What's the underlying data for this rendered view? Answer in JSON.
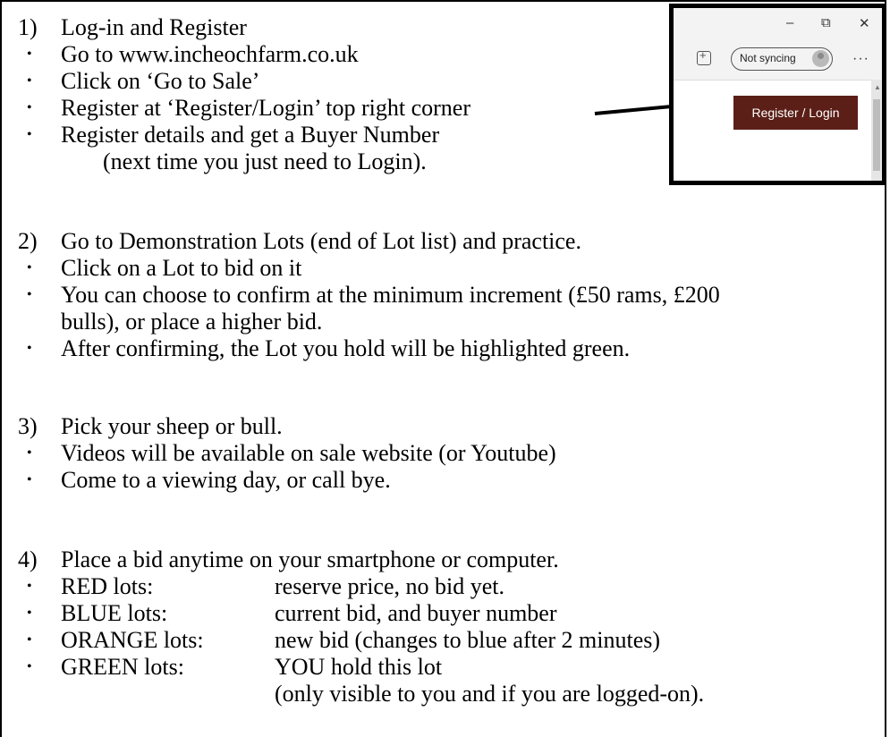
{
  "sections": [
    {
      "number": "1)",
      "heading": "Log-in and Register",
      "bullets": [
        "Go to www.incheochfarm.co.uk",
        "Click on ‘Go to Sale’",
        "Register at ‘Register/Login’ top right corner",
        "Register details and get a Buyer Number"
      ],
      "note": "(next time you just need to Login)."
    },
    {
      "number": "2)",
      "heading": "Go to Demonstration Lots (end of Lot list) and practice.",
      "bullets": [
        "Click on a Lot to bid on it",
        "You can choose to confirm at the minimum increment (£50 rams, £200",
        "After confirming, the Lot you hold will be highlighted green."
      ],
      "continuation": "bulls), or place a higher bid."
    },
    {
      "number": "3)",
      "heading": "Pick your sheep or bull.",
      "bullets": [
        "Videos will be available on sale website (or Youtube)",
        "Come to a viewing day, or call bye."
      ]
    },
    {
      "number": "4)",
      "heading": "Place a bid anytime on your smartphone or computer.",
      "lots": [
        {
          "label": "RED lots:",
          "desc": "reserve price, no bid yet."
        },
        {
          "label": "BLUE lots:",
          "desc": "current bid, and buyer number"
        },
        {
          "label": "ORANGE lots:",
          "desc": "new bid (changes to blue after 2 minutes)"
        },
        {
          "label": "GREEN lots:",
          "desc": "YOU hold this lot"
        }
      ],
      "lot_note": "(only visible to you and if you are logged-on)."
    }
  ],
  "bullet_char": "•",
  "browser_snippet": {
    "minimize": "–",
    "restore": "⧉",
    "close": "✕",
    "sync_label": "Not syncing",
    "more_label": "···",
    "button_label": "Register / Login",
    "button_color": "#5b1f17"
  }
}
